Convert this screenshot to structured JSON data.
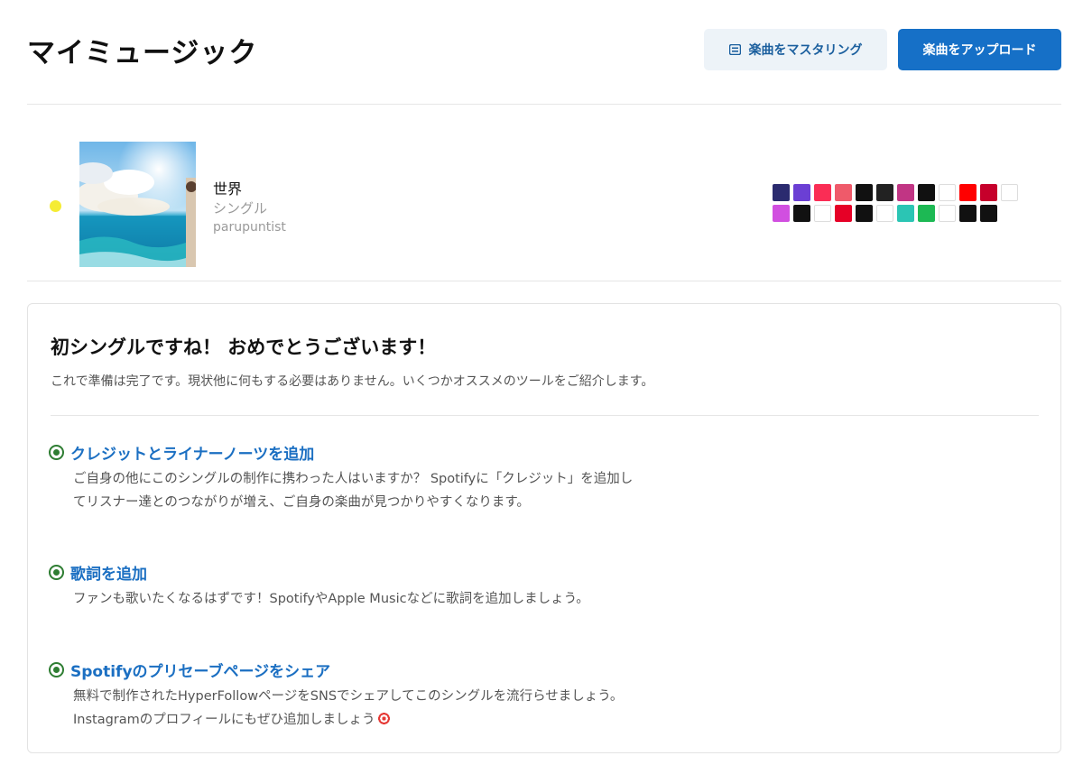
{
  "header": {
    "title": "マイミュージック",
    "master_button": "楽曲をマスタリング",
    "upload_button": "楽曲をアップロード"
  },
  "release": {
    "title": "世界",
    "type": "シングル",
    "artist": "parupuntist",
    "status_color": "#f5ec33",
    "stores": [
      {
        "name": "amazon-music",
        "bg": "#2b2b6f"
      },
      {
        "name": "anghami",
        "bg": "#6b3fd4"
      },
      {
        "name": "apple-music",
        "bg": "#fa2d55"
      },
      {
        "name": "melon",
        "bg": "#ef5a6a"
      },
      {
        "name": "boomplay",
        "bg": "#111111"
      },
      {
        "name": "deezer",
        "bg": "#222222"
      },
      {
        "name": "instagram",
        "bg": "#c13584"
      },
      {
        "name": "joox",
        "bg": "#111111"
      },
      {
        "name": "flo",
        "bg": "#ffffff"
      },
      {
        "name": "youtube-music",
        "bg": "#ff0000"
      },
      {
        "name": "iheartradio",
        "bg": "#c6002b"
      },
      {
        "name": "kkbox",
        "bg": "#ffffff"
      },
      {
        "name": "itunes",
        "bg": "#d14fe0"
      },
      {
        "name": "audiomack",
        "bg": "#111111"
      },
      {
        "name": "jiosaavn-k",
        "bg": "#ffffff"
      },
      {
        "name": "netease",
        "bg": "#e60026"
      },
      {
        "name": "qobuz",
        "bg": "#111111"
      },
      {
        "name": "pandora",
        "bg": "#ffffff"
      },
      {
        "name": "saavn",
        "bg": "#2bc5b4"
      },
      {
        "name": "spotify",
        "bg": "#1db954"
      },
      {
        "name": "qq-music",
        "bg": "#ffffff"
      },
      {
        "name": "tidal",
        "bg": "#111111"
      },
      {
        "name": "tiktok",
        "bg": "#111111"
      }
    ]
  },
  "card": {
    "title": "初シングルですね！ おめでとうございます！",
    "description": "これで準備は完了です。現状他に何もする必要はありません。いくつかオススメのツールをご紹介します。",
    "tips": [
      {
        "title": "クレジットとライナーノーツを追加",
        "body": "ご自身の他にこのシングルの制作に携わった人はいますか？ Spotifyに「クレジット」を追加してリスナー達とのつながりが増え、ご自身の楽曲が見つかりやすくなります。"
      },
      {
        "title": "歌詞を追加",
        "body": "ファンも歌いたくなるはずです！SpotifyやApple Musicなどに歌詞を追加しましょう。"
      },
      {
        "title": "Spotifyのプリセーブページをシェア",
        "body": "無料で制作されたHyperFollowページをSNSでシェアしてこのシングルを流行らせましょう。Instagramのプロフィールにもぜひ追加しましょう"
      }
    ],
    "tip_icon_color": "#2e7d32",
    "link_color": "#1b6fc2"
  }
}
